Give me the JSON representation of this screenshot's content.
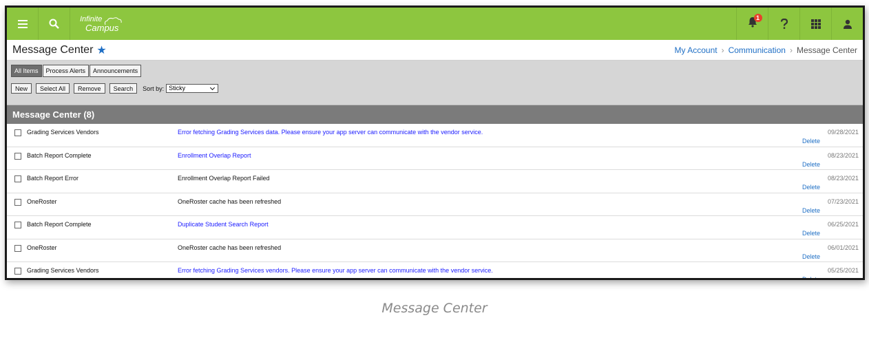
{
  "app": {
    "logo_line1": "Infinite",
    "logo_line2": "Campus",
    "notification_count": "1"
  },
  "page": {
    "title": "Message Center"
  },
  "breadcrumb": {
    "items": [
      "My Account",
      "Communication",
      "Message Center"
    ]
  },
  "tabs": [
    {
      "label": "All Items",
      "active": true
    },
    {
      "label": "Process Alerts",
      "active": false
    },
    {
      "label": "Announcements",
      "active": false
    }
  ],
  "actions": {
    "new": "New",
    "select_all": "Select All",
    "remove": "Remove",
    "search": "Search"
  },
  "sort": {
    "label": "Sort by:",
    "value": "Sticky"
  },
  "list": {
    "header": "Message Center (8)",
    "delete_label": "Delete",
    "rows": [
      {
        "source": "Grading Services Vendors",
        "message": "Error fetching Grading Services data. Please ensure your app server can communicate with the vendor service.",
        "link": true,
        "date": "09/28/2021"
      },
      {
        "source": "Batch Report Complete",
        "message": "Enrollment Overlap Report",
        "link": true,
        "date": "08/23/2021"
      },
      {
        "source": "Batch Report Error",
        "message": "Enrollment Overlap Report Failed",
        "link": false,
        "date": "08/23/2021"
      },
      {
        "source": "OneRoster",
        "message": "OneRoster cache has been refreshed",
        "link": false,
        "date": "07/23/2021"
      },
      {
        "source": "Batch Report Complete",
        "message": "Duplicate Student Search Report",
        "link": true,
        "date": "06/25/2021"
      },
      {
        "source": "OneRoster",
        "message": "OneRoster cache has been refreshed",
        "link": false,
        "date": "06/01/2021"
      },
      {
        "source": "Grading Services Vendors",
        "message": "Error fetching Grading Services vendors. Please ensure your app server can communicate with the vendor service.",
        "link": true,
        "date": "05/25/2021"
      }
    ]
  },
  "caption": "Message Center",
  "colors": {
    "brand_green": "#8dc63f",
    "link_blue": "#1f6fc5",
    "header_gray": "#7b7b7b",
    "badge_red": "#e8412c"
  }
}
